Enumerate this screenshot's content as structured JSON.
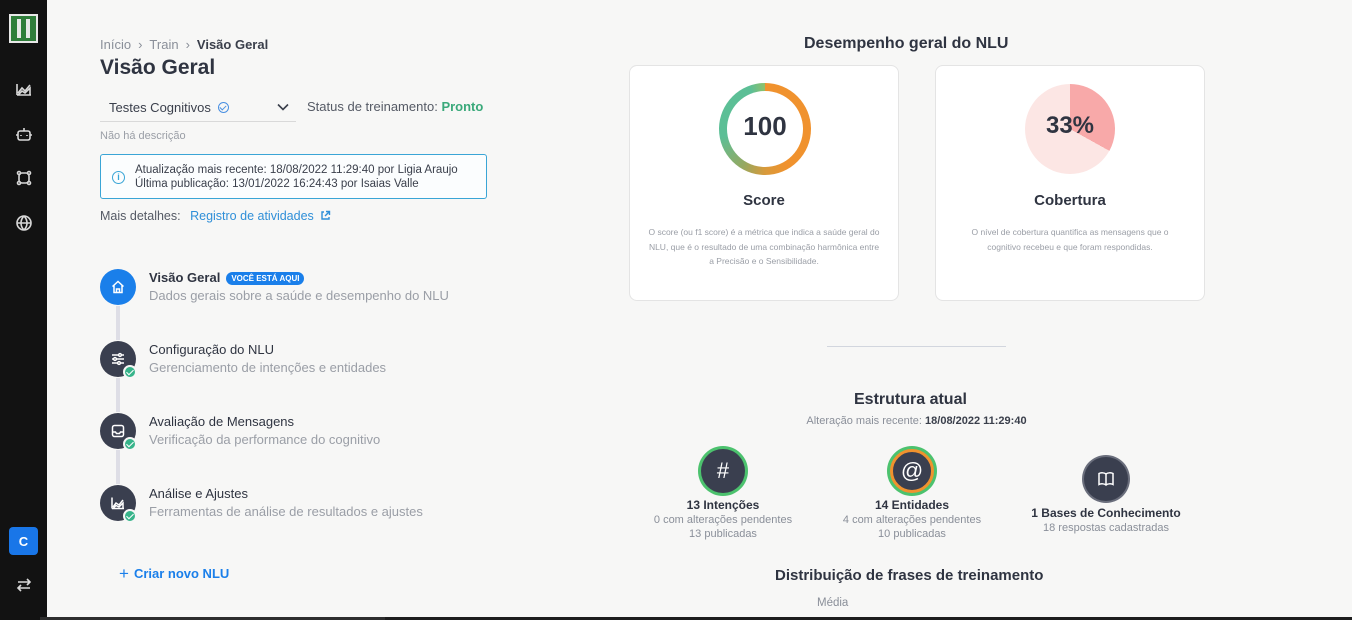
{
  "sidebar": {
    "icons": [
      "chart-line-icon",
      "robot-icon",
      "hub-icon",
      "globe-icon"
    ],
    "avatar_letter": "C"
  },
  "breadcrumb": [
    "Início",
    "Train",
    "Visão Geral"
  ],
  "page_title": "Visão Geral",
  "nlu_select": {
    "value": "Testes Cognitivos"
  },
  "status": {
    "label": "Status de treinamento:",
    "value": "Pronto"
  },
  "description": "Não há descrição",
  "info": {
    "line1_prefix": "Atualização mais recente: ",
    "line1_date": "18/08/2022 11:29:40",
    "line1_by": " por ",
    "line1_user": "Ligia Araujo",
    "line2_prefix": "Última publicação: ",
    "line2_date": "13/01/2022 16:24:43",
    "line2_by": " por ",
    "line2_user": "Isaias Valle"
  },
  "more_details": {
    "label": "Mais detalhes:",
    "link": "Registro de atividades"
  },
  "steps": [
    {
      "title": "Visão Geral",
      "badge": "VOCÊ ESTÁ AQUI",
      "subtitle": "Dados gerais sobre a saúde e desempenho do NLU"
    },
    {
      "title": "Configuração do NLU",
      "subtitle": "Gerenciamento de intenções e entidades"
    },
    {
      "title": "Avaliação de Mensagens",
      "subtitle": "Verificação da performance do cognitivo"
    },
    {
      "title": "Análise e Ajustes",
      "subtitle": "Ferramentas de análise de resultados e ajustes"
    }
  ],
  "create_nlu": "Criar novo NLU",
  "performance": {
    "title": "Desempenho geral do NLU",
    "score": {
      "value": "100",
      "title": "Score",
      "description": "O score (ou f1 score) é a métrica que indica a saúde geral do NLU, que é o resultado de uma combinação harmônica entre a Precisão e o Sensibilidade."
    },
    "coverage": {
      "value": "33%",
      "fraction": 0.33,
      "title": "Cobertura",
      "description": "O nível de cobertura quantifica as mensagens que o cognitivo recebeu e que foram respondidas."
    }
  },
  "structure": {
    "title": "Estrutura atual",
    "change_label": "Alteração mais recente: ",
    "change_date": "18/08/2022 11:29:40",
    "intents": {
      "label": "13 Intenções",
      "line1": "0 com alterações pendentes",
      "line2": "13 publicadas"
    },
    "entities": {
      "label": "14 Entidades",
      "line1": "4 com alterações pendentes",
      "line2": "10 publicadas"
    },
    "knowledge": {
      "label": "1 Bases de Conhecimento",
      "line1": "18 respostas cadastradas"
    }
  },
  "distribution": {
    "title": "Distribuição de frases de treinamento",
    "media": "Média"
  },
  "colors": {
    "primary": "#1a7fea",
    "success": "#3aa97a",
    "info_border": "#3aa5d6",
    "coverage": "#f8a9a9"
  }
}
